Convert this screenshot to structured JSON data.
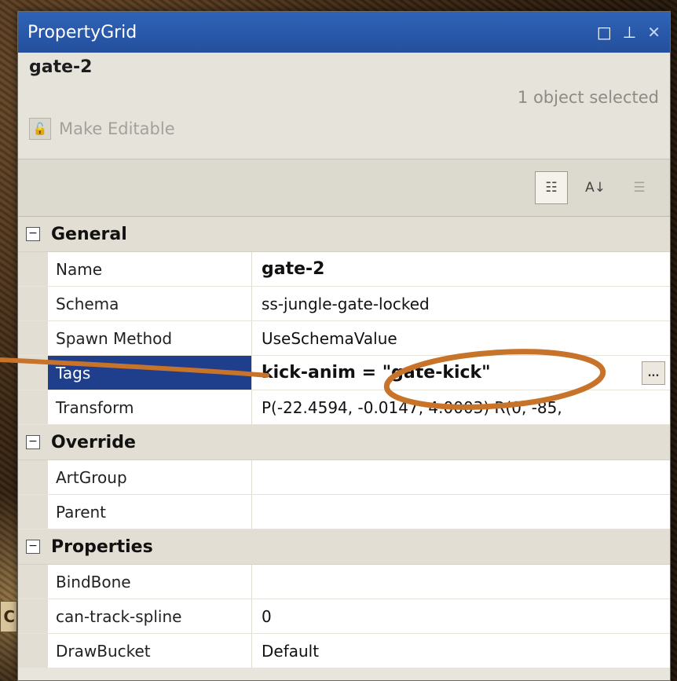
{
  "window": {
    "title": "PropertyGrid",
    "maximize_icon": "restore-icon",
    "pin_icon": "pin-icon",
    "close_icon": "close-icon"
  },
  "header": {
    "object_name": "gate-2",
    "selection_status": "1 object selected",
    "make_editable_label": "Make Editable"
  },
  "toolbar": {
    "buttons": [
      "categorized-icon",
      "alphabetical-icon",
      "property-pages-icon"
    ]
  },
  "backdrop": {
    "edge_text": "C"
  },
  "categories": [
    {
      "label": "General",
      "toggle": "⊟",
      "rows": [
        {
          "name": "Name",
          "value": "gate-2"
        },
        {
          "name": "Schema",
          "value": "ss-jungle-gate-locked"
        },
        {
          "name": "Spawn Method",
          "value": "UseSchemaValue"
        },
        {
          "name": "Tags",
          "value": "kick-anim = \"gate-kick\"",
          "ellipsis": "..."
        },
        {
          "name": "Transform",
          "value": "P(-22.4594, -0.0147, 4.0003) R(0, -85,"
        }
      ]
    },
    {
      "label": "Override",
      "toggle": "⊟",
      "rows": [
        {
          "name": "ArtGroup",
          "value": ""
        },
        {
          "name": "Parent",
          "value": ""
        }
      ]
    },
    {
      "label": "Properties",
      "toggle": "⊟",
      "rows": [
        {
          "name": "BindBone",
          "value": ""
        },
        {
          "name": "can-track-spline",
          "value": "0"
        },
        {
          "name": "DrawBucket",
          "value": "Default"
        }
      ]
    }
  ],
  "colors": {
    "titlebar": "#2f63b8",
    "selected_row": "#1f3f8d",
    "annotation": "#c8732a"
  }
}
